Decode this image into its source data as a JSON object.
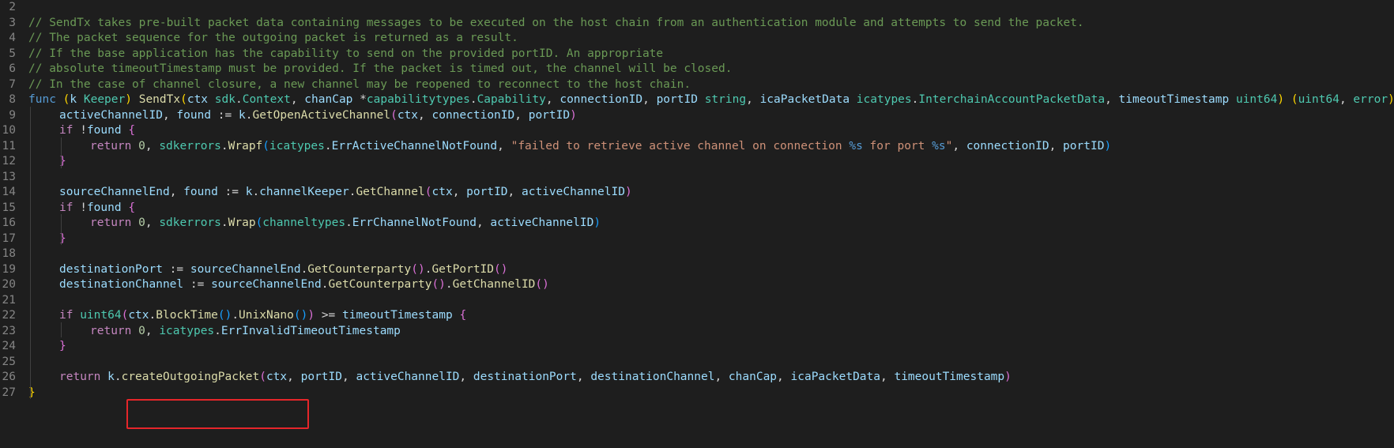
{
  "editor": {
    "colors": {
      "background": "#1e1e1e",
      "comment": "#6a9955",
      "keyword": "#569cd6",
      "control": "#c586c0",
      "function": "#dcdcaa",
      "type": "#4ec9b0",
      "variable": "#9cdcfe",
      "string": "#ce9178",
      "number": "#b5cea8",
      "highlight_box": "#e5262a"
    },
    "highlight_box": {
      "target": "createOutgoingPacket(ctx,"
    },
    "lines": [
      {
        "n": "2",
        "indent": 0,
        "tokens": []
      },
      {
        "n": "3",
        "indent": 0,
        "tokens": [
          [
            "c-comment",
            "// SendTx takes pre-built packet data containing messages to be executed on the host chain from an authentication module and attempts to send the packet."
          ]
        ]
      },
      {
        "n": "4",
        "indent": 0,
        "tokens": [
          [
            "c-comment",
            "// The packet sequence for the outgoing packet is returned as a result."
          ]
        ]
      },
      {
        "n": "5",
        "indent": 0,
        "tokens": [
          [
            "c-comment",
            "// If the base application has the capability to send on the provided portID. An appropriate"
          ]
        ]
      },
      {
        "n": "6",
        "indent": 0,
        "tokens": [
          [
            "c-comment",
            "// absolute timeoutTimestamp must be provided. If the packet is timed out, the channel will be closed."
          ]
        ]
      },
      {
        "n": "7",
        "indent": 0,
        "tokens": [
          [
            "c-comment",
            "// In the case of channel closure, a new channel may be reopened to reconnect to the host chain."
          ]
        ]
      },
      {
        "n": "8",
        "indent": 0,
        "tokens": [
          [
            "c-kw",
            "func"
          ],
          [
            "c-plain",
            " "
          ],
          [
            "c-br1",
            "("
          ],
          [
            "c-var",
            "k"
          ],
          [
            "c-plain",
            " "
          ],
          [
            "c-type",
            "Keeper"
          ],
          [
            "c-br1",
            ")"
          ],
          [
            "c-plain",
            " "
          ],
          [
            "c-fn",
            "SendTx"
          ],
          [
            "c-br1",
            "("
          ],
          [
            "c-var",
            "ctx"
          ],
          [
            "c-plain",
            " "
          ],
          [
            "c-type",
            "sdk"
          ],
          [
            "c-plain",
            "."
          ],
          [
            "c-type",
            "Context"
          ],
          [
            "c-plain",
            ", "
          ],
          [
            "c-var",
            "chanCap"
          ],
          [
            "c-plain",
            " *"
          ],
          [
            "c-type",
            "capabilitytypes"
          ],
          [
            "c-plain",
            "."
          ],
          [
            "c-type",
            "Capability"
          ],
          [
            "c-plain",
            ", "
          ],
          [
            "c-var",
            "connectionID"
          ],
          [
            "c-plain",
            ", "
          ],
          [
            "c-var",
            "portID"
          ],
          [
            "c-plain",
            " "
          ],
          [
            "c-type",
            "string"
          ],
          [
            "c-plain",
            ", "
          ],
          [
            "c-var",
            "icaPacketData"
          ],
          [
            "c-plain",
            " "
          ],
          [
            "c-type",
            "icatypes"
          ],
          [
            "c-plain",
            "."
          ],
          [
            "c-type",
            "InterchainAccountPacketData"
          ],
          [
            "c-plain",
            ", "
          ],
          [
            "c-var",
            "timeoutTimestamp"
          ],
          [
            "c-plain",
            " "
          ],
          [
            "c-type",
            "uint64"
          ],
          [
            "c-br1",
            ")"
          ],
          [
            "c-plain",
            " "
          ],
          [
            "c-br1",
            "("
          ],
          [
            "c-type",
            "uint64"
          ],
          [
            "c-plain",
            ", "
          ],
          [
            "c-type",
            "error"
          ],
          [
            "c-br1",
            ")"
          ],
          [
            "c-plain",
            " "
          ],
          [
            "c-br1",
            "{"
          ]
        ]
      },
      {
        "n": "9",
        "indent": 1,
        "tokens": [
          [
            "c-var",
            "activeChannelID"
          ],
          [
            "c-plain",
            ", "
          ],
          [
            "c-var",
            "found"
          ],
          [
            "c-plain",
            " := "
          ],
          [
            "c-var",
            "k"
          ],
          [
            "c-plain",
            "."
          ],
          [
            "c-fn",
            "GetOpenActiveChannel"
          ],
          [
            "c-br2",
            "("
          ],
          [
            "c-var",
            "ctx"
          ],
          [
            "c-plain",
            ", "
          ],
          [
            "c-var",
            "connectionID"
          ],
          [
            "c-plain",
            ", "
          ],
          [
            "c-var",
            "portID"
          ],
          [
            "c-br2",
            ")"
          ]
        ]
      },
      {
        "n": "10",
        "indent": 1,
        "tokens": [
          [
            "c-ctrl",
            "if"
          ],
          [
            "c-plain",
            " !"
          ],
          [
            "c-var",
            "found"
          ],
          [
            "c-plain",
            " "
          ],
          [
            "c-br2",
            "{"
          ]
        ]
      },
      {
        "n": "11",
        "indent": 2,
        "tokens": [
          [
            "c-ctrl",
            "return"
          ],
          [
            "c-plain",
            " "
          ],
          [
            "c-num",
            "0"
          ],
          [
            "c-plain",
            ", "
          ],
          [
            "c-type",
            "sdkerrors"
          ],
          [
            "c-plain",
            "."
          ],
          [
            "c-fn",
            "Wrapf"
          ],
          [
            "c-br3",
            "("
          ],
          [
            "c-type",
            "icatypes"
          ],
          [
            "c-plain",
            "."
          ],
          [
            "c-var",
            "ErrActiveChannelNotFound"
          ],
          [
            "c-plain",
            ", "
          ],
          [
            "c-str",
            "\"failed to retrieve active channel on connection "
          ],
          [
            "c-fmt",
            "%s"
          ],
          [
            "c-str",
            " for port "
          ],
          [
            "c-fmt",
            "%s"
          ],
          [
            "c-str",
            "\""
          ],
          [
            "c-plain",
            ", "
          ],
          [
            "c-var",
            "connectionID"
          ],
          [
            "c-plain",
            ", "
          ],
          [
            "c-var",
            "portID"
          ],
          [
            "c-br3",
            ")"
          ]
        ]
      },
      {
        "n": "12",
        "indent": 1,
        "tokens": [
          [
            "c-br2",
            "}"
          ]
        ]
      },
      {
        "n": "13",
        "indent": 1,
        "tokens": []
      },
      {
        "n": "14",
        "indent": 1,
        "tokens": [
          [
            "c-var",
            "sourceChannelEnd"
          ],
          [
            "c-plain",
            ", "
          ],
          [
            "c-var",
            "found"
          ],
          [
            "c-plain",
            " := "
          ],
          [
            "c-var",
            "k"
          ],
          [
            "c-plain",
            "."
          ],
          [
            "c-var",
            "channelKeeper"
          ],
          [
            "c-plain",
            "."
          ],
          [
            "c-fn",
            "GetChannel"
          ],
          [
            "c-br2",
            "("
          ],
          [
            "c-var",
            "ctx"
          ],
          [
            "c-plain",
            ", "
          ],
          [
            "c-var",
            "portID"
          ],
          [
            "c-plain",
            ", "
          ],
          [
            "c-var",
            "activeChannelID"
          ],
          [
            "c-br2",
            ")"
          ]
        ]
      },
      {
        "n": "15",
        "indent": 1,
        "tokens": [
          [
            "c-ctrl",
            "if"
          ],
          [
            "c-plain",
            " !"
          ],
          [
            "c-var",
            "found"
          ],
          [
            "c-plain",
            " "
          ],
          [
            "c-br2",
            "{"
          ]
        ]
      },
      {
        "n": "16",
        "indent": 2,
        "tokens": [
          [
            "c-ctrl",
            "return"
          ],
          [
            "c-plain",
            " "
          ],
          [
            "c-num",
            "0"
          ],
          [
            "c-plain",
            ", "
          ],
          [
            "c-type",
            "sdkerrors"
          ],
          [
            "c-plain",
            "."
          ],
          [
            "c-fn",
            "Wrap"
          ],
          [
            "c-br3",
            "("
          ],
          [
            "c-type",
            "channeltypes"
          ],
          [
            "c-plain",
            "."
          ],
          [
            "c-var",
            "ErrChannelNotFound"
          ],
          [
            "c-plain",
            ", "
          ],
          [
            "c-var",
            "activeChannelID"
          ],
          [
            "c-br3",
            ")"
          ]
        ]
      },
      {
        "n": "17",
        "indent": 1,
        "tokens": [
          [
            "c-br2",
            "}"
          ]
        ]
      },
      {
        "n": "18",
        "indent": 1,
        "tokens": []
      },
      {
        "n": "19",
        "indent": 1,
        "tokens": [
          [
            "c-var",
            "destinationPort"
          ],
          [
            "c-plain",
            " := "
          ],
          [
            "c-var",
            "sourceChannelEnd"
          ],
          [
            "c-plain",
            "."
          ],
          [
            "c-fn",
            "GetCounterparty"
          ],
          [
            "c-br2",
            "()"
          ],
          [
            "c-plain",
            "."
          ],
          [
            "c-fn",
            "GetPortID"
          ],
          [
            "c-br2",
            "()"
          ]
        ]
      },
      {
        "n": "20",
        "indent": 1,
        "tokens": [
          [
            "c-var",
            "destinationChannel"
          ],
          [
            "c-plain",
            " := "
          ],
          [
            "c-var",
            "sourceChannelEnd"
          ],
          [
            "c-plain",
            "."
          ],
          [
            "c-fn",
            "GetCounterparty"
          ],
          [
            "c-br2",
            "()"
          ],
          [
            "c-plain",
            "."
          ],
          [
            "c-fn",
            "GetChannelID"
          ],
          [
            "c-br2",
            "()"
          ]
        ]
      },
      {
        "n": "21",
        "indent": 1,
        "tokens": []
      },
      {
        "n": "22",
        "indent": 1,
        "tokens": [
          [
            "c-ctrl",
            "if"
          ],
          [
            "c-plain",
            " "
          ],
          [
            "c-type",
            "uint64"
          ],
          [
            "c-br2",
            "("
          ],
          [
            "c-var",
            "ctx"
          ],
          [
            "c-plain",
            "."
          ],
          [
            "c-fn",
            "BlockTime"
          ],
          [
            "c-br3",
            "()"
          ],
          [
            "c-plain",
            "."
          ],
          [
            "c-fn",
            "UnixNano"
          ],
          [
            "c-br3",
            "()"
          ],
          [
            "c-br2",
            ")"
          ],
          [
            "c-plain",
            " >= "
          ],
          [
            "c-var",
            "timeoutTimestamp"
          ],
          [
            "c-plain",
            " "
          ],
          [
            "c-br2",
            "{"
          ]
        ]
      },
      {
        "n": "23",
        "indent": 2,
        "tokens": [
          [
            "c-ctrl",
            "return"
          ],
          [
            "c-plain",
            " "
          ],
          [
            "c-num",
            "0"
          ],
          [
            "c-plain",
            ", "
          ],
          [
            "c-type",
            "icatypes"
          ],
          [
            "c-plain",
            "."
          ],
          [
            "c-var",
            "ErrInvalidTimeoutTimestamp"
          ]
        ]
      },
      {
        "n": "24",
        "indent": 1,
        "tokens": [
          [
            "c-br2",
            "}"
          ]
        ]
      },
      {
        "n": "25",
        "indent": 1,
        "tokens": []
      },
      {
        "n": "26",
        "indent": 1,
        "tokens": [
          [
            "c-ctrl",
            "return"
          ],
          [
            "c-plain",
            " "
          ],
          [
            "c-var",
            "k"
          ],
          [
            "c-plain",
            "."
          ],
          [
            "c-fn",
            "createOutgoingPacket"
          ],
          [
            "c-br2",
            "("
          ],
          [
            "c-var",
            "ctx"
          ],
          [
            "c-plain",
            ", "
          ],
          [
            "c-var",
            "portID"
          ],
          [
            "c-plain",
            ", "
          ],
          [
            "c-var",
            "activeChannelID"
          ],
          [
            "c-plain",
            ", "
          ],
          [
            "c-var",
            "destinationPort"
          ],
          [
            "c-plain",
            ", "
          ],
          [
            "c-var",
            "destinationChannel"
          ],
          [
            "c-plain",
            ", "
          ],
          [
            "c-var",
            "chanCap"
          ],
          [
            "c-plain",
            ", "
          ],
          [
            "c-var",
            "icaPacketData"
          ],
          [
            "c-plain",
            ", "
          ],
          [
            "c-var",
            "timeoutTimestamp"
          ],
          [
            "c-br2",
            ")"
          ]
        ]
      },
      {
        "n": "27",
        "indent": 0,
        "tokens": [
          [
            "c-br1",
            "}"
          ]
        ]
      }
    ]
  }
}
